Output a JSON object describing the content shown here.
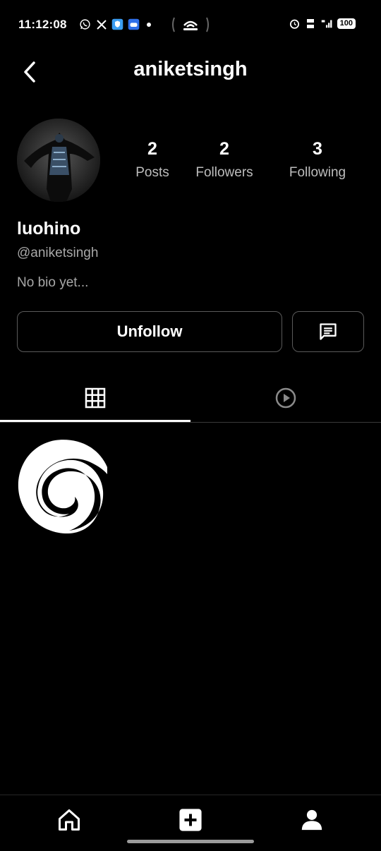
{
  "status_bar": {
    "time": "11:12:08",
    "battery": "100",
    "left_icons": [
      "whatsapp-icon",
      "x-icon",
      "shield-app-icon",
      "game-controller-icon"
    ],
    "right_icons": [
      "alarm-icon",
      "volte-icon",
      "5g-signal-icon",
      "battery-icon"
    ]
  },
  "header": {
    "title": "aniketsingh"
  },
  "profile": {
    "stats": [
      {
        "value": "2",
        "label": "Posts"
      },
      {
        "value": "2",
        "label": "Followers"
      },
      {
        "value": "3",
        "label": "Following"
      }
    ],
    "display_name": "luohino",
    "handle": "@aniketsingh",
    "bio": "No bio yet..."
  },
  "actions": {
    "unfollow_label": "Unfollow"
  },
  "tabs": [
    "grid-icon",
    "play-circle-icon"
  ],
  "bottom_nav": [
    "home-icon",
    "add-post-icon",
    "profile-icon"
  ]
}
